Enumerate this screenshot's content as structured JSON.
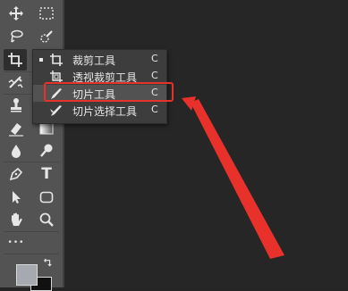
{
  "toolbar": {
    "tools": [
      {
        "name": "move-tool-icon"
      },
      {
        "name": "marquee-tool-icon"
      },
      {
        "name": "lasso-tool-icon"
      },
      {
        "name": "quick-select-tool-icon"
      },
      {
        "name": "crop-tool-icon"
      },
      {
        "name": "frame-tool-icon"
      },
      {
        "name": "eyedropper-tool-icon"
      },
      {
        "name": "healing-brush-tool-icon"
      },
      {
        "name": "brush-tool-icon"
      },
      {
        "name": "clone-stamp-tool-icon"
      },
      {
        "name": "history-brush-tool-icon"
      },
      {
        "name": "eraser-tool-icon"
      },
      {
        "name": "gradient-tool-icon"
      },
      {
        "name": "blur-tool-icon"
      },
      {
        "name": "dodge-tool-icon"
      },
      {
        "name": "pen-tool-icon"
      },
      {
        "name": "type-tool-icon"
      },
      {
        "name": "path-select-tool-icon"
      },
      {
        "name": "shape-tool-icon"
      },
      {
        "name": "hand-tool-icon"
      },
      {
        "name": "zoom-tool-icon"
      },
      {
        "name": "more-tools-icon"
      }
    ],
    "type_glyph": "T",
    "more_glyph": "•••"
  },
  "flyout": {
    "items": [
      {
        "label": "裁剪工具",
        "key": "C",
        "icon": "crop-icon",
        "selected": true
      },
      {
        "label": "透视裁剪工具",
        "key": "C",
        "icon": "perspective-crop-icon"
      },
      {
        "label": "切片工具",
        "key": "C",
        "icon": "slice-icon",
        "highlighted": true
      },
      {
        "label": "切片选择工具",
        "key": "C",
        "icon": "slice-select-icon"
      }
    ]
  },
  "colors": {
    "highlight": "#e8312a",
    "foreground_swatch": "#a6a9b0",
    "background_swatch": "#111111"
  }
}
